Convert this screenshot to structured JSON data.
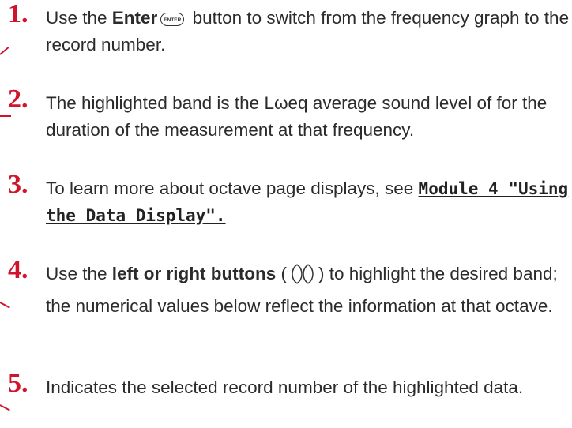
{
  "steps": [
    {
      "number": "1.",
      "before": "Use the ",
      "bold": "Enter",
      "icon": "ENTER",
      "after": " button to switch from the frequency graph to the record number."
    },
    {
      "number": "2.",
      "text": "The highlighted band is the Lωeq average sound level of for the duration of the measurement at that frequency."
    },
    {
      "number": "3.",
      "before": "To learn more about octave page displays, see ",
      "link": "Module 4 \"Using the Data Display\"."
    },
    {
      "number": "4.",
      "before": "Use the ",
      "bold": "left or right buttons",
      "open_paren": " (",
      "close_paren": ")",
      "after": " to highlight the desired band; the numerical values below reflect the information at that octave."
    },
    {
      "number": "5.",
      "text": "Indicates the selected record number of the highlighted data."
    }
  ],
  "colors": {
    "number": "#d0142c",
    "text": "#2b2b2b"
  },
  "icons": [
    "enter-button-icon",
    "left-right-buttons-icon"
  ]
}
